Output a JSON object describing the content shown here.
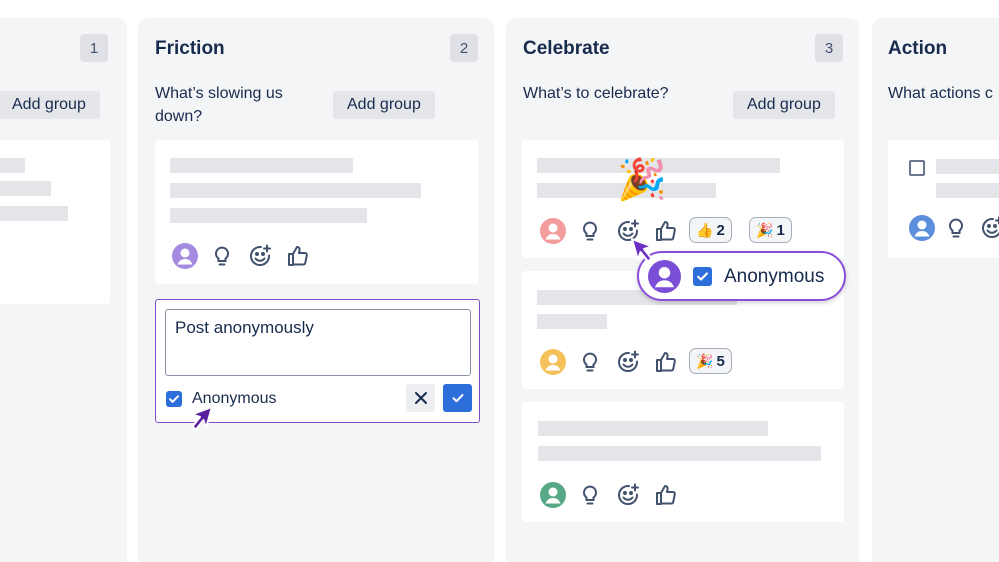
{
  "columns": [
    {
      "title": "",
      "count": "1",
      "description": "",
      "add_group": "Add group"
    },
    {
      "title": "Friction",
      "count": "2",
      "description_lines": [
        "What’s slowing us",
        "down?"
      ],
      "add_group": "Add group"
    },
    {
      "title": "Celebrate",
      "count": "3",
      "description": "What’s to celebrate?",
      "add_group": "Add group"
    },
    {
      "title": "Action",
      "description": "What actions c"
    }
  ],
  "friction_editor": {
    "text": "Post anonymously",
    "anonymous_label": "Anonymous",
    "anonymous_checked": true
  },
  "celebrate_cards": [
    {
      "avatar_color": "#f29c9c",
      "reactions": [
        {
          "emoji": "👍",
          "count": "2"
        },
        {
          "emoji": "🎉",
          "count": "1"
        }
      ]
    },
    {
      "avatar_color": "#f5c15a",
      "reactions": [
        {
          "emoji": "🎉",
          "count": "5"
        }
      ]
    },
    {
      "avatar_color": "#57a886",
      "reactions": []
    }
  ],
  "friction_card": {
    "avatar_color": "#a58be0"
  },
  "action_card": {
    "avatar_color": "#5b8fdb"
  },
  "popover": {
    "label": "Anonymous",
    "avatar_color": "#7a4ed6",
    "checked": true
  },
  "decoration": {
    "party_emoji": "🎉"
  },
  "colors": {
    "accent_purple": "#7c4dcb",
    "checkbox_blue": "#2c6fdb",
    "column_bg": "#f4f5f7"
  }
}
